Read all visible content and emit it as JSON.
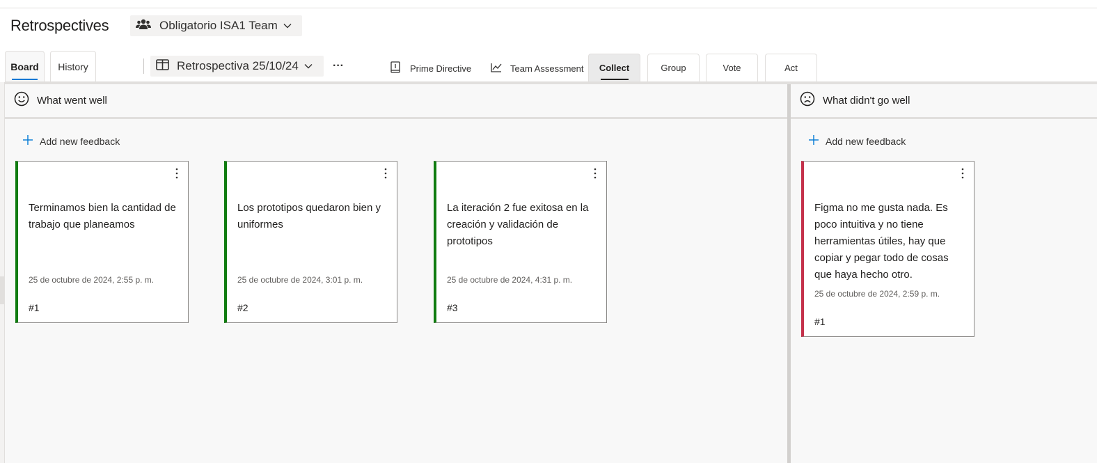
{
  "header": {
    "title": "Retrospectives",
    "team": "Obligatorio ISA1 Team"
  },
  "tabs": [
    {
      "label": "Board",
      "selected": true
    },
    {
      "label": "History",
      "selected": false
    }
  ],
  "toolbar": {
    "board_name": "Retrospectiva 25/10/24",
    "more": "···"
  },
  "phases": {
    "prime_directive": "Prime Directive",
    "team_assessment": "Team Assessment"
  },
  "stages": [
    {
      "label": "Collect",
      "active": true
    },
    {
      "label": "Group",
      "active": false
    },
    {
      "label": "Vote",
      "active": false
    },
    {
      "label": "Act",
      "active": false
    }
  ],
  "columns": [
    {
      "title": "What went well",
      "icon": "smile-icon",
      "accent": "#107c10",
      "add_label": "Add new feedback",
      "cards": [
        {
          "text": "Terminamos bien la cantidad de trabajo que planeamos",
          "date": "25 de octubre de 2024, 2:55 p. m.",
          "number": "#1"
        },
        {
          "text": "Los prototipos quedaron bien y uniformes",
          "date": "25 de octubre de 2024, 3:01 p. m.",
          "number": "#2"
        },
        {
          "text": "La iteración 2 fue exitosa en la creación y validación de prototipos",
          "date": "25 de octubre de 2024, 4:31 p. m.",
          "number": "#3"
        }
      ]
    },
    {
      "title": "What didn't go well",
      "icon": "sad-icon",
      "accent": "#c4314b",
      "add_label": "Add new feedback",
      "cards": [
        {
          "text": "Figma no me gusta nada. Es poco intuitiva y no tiene herramientas útiles, hay que copiar y pegar todo de cosas que haya hecho otro.",
          "date": "25 de octubre de 2024, 2:59 p. m.",
          "number": "#1"
        }
      ]
    }
  ]
}
